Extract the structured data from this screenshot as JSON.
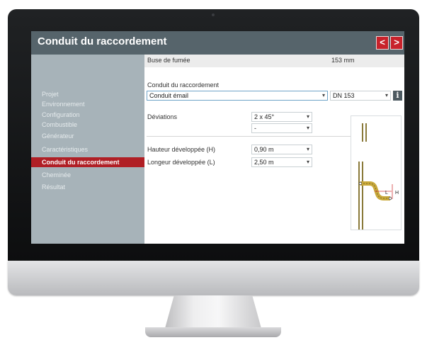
{
  "window": {
    "title": "Conduit du raccordement"
  },
  "nav": {
    "prev_glyph": "<",
    "next_glyph": ">"
  },
  "sidebar": {
    "items": [
      {
        "label": "Projet"
      },
      {
        "label": "Environnement"
      },
      {
        "label": "Configuration"
      },
      {
        "label": "Combustible"
      },
      {
        "label": "Générateur"
      },
      {
        "label": "Caractéristiques"
      },
      {
        "label": "Conduit du raccordement",
        "active": true
      },
      {
        "label": "Cheminée"
      },
      {
        "label": "Résultat"
      }
    ]
  },
  "content": {
    "buse": {
      "label": "Buse de fumée",
      "value": "153 mm"
    },
    "conduit": {
      "label": "Conduit du raccordement",
      "type_value": "Conduit émail",
      "dn_value": "DN 153",
      "info_glyph": "i"
    },
    "deviations": {
      "label": "Déviations",
      "value1": "2 x 45°",
      "value2": "-"
    },
    "hauteur": {
      "label": "Hauteur développée (H)",
      "value": "0,90 m"
    },
    "longueur": {
      "label": "Longeur développée (L)",
      "value": "2,50 m"
    },
    "diagram": {
      "label_l": "L",
      "label_h": "H"
    }
  },
  "colors": {
    "titlebar": "#56646b",
    "sidebar": "#a7b3b9",
    "accent_red": "#b01f25",
    "nav_button": "#c8222b",
    "pipe_gold": "#c9a93a"
  }
}
